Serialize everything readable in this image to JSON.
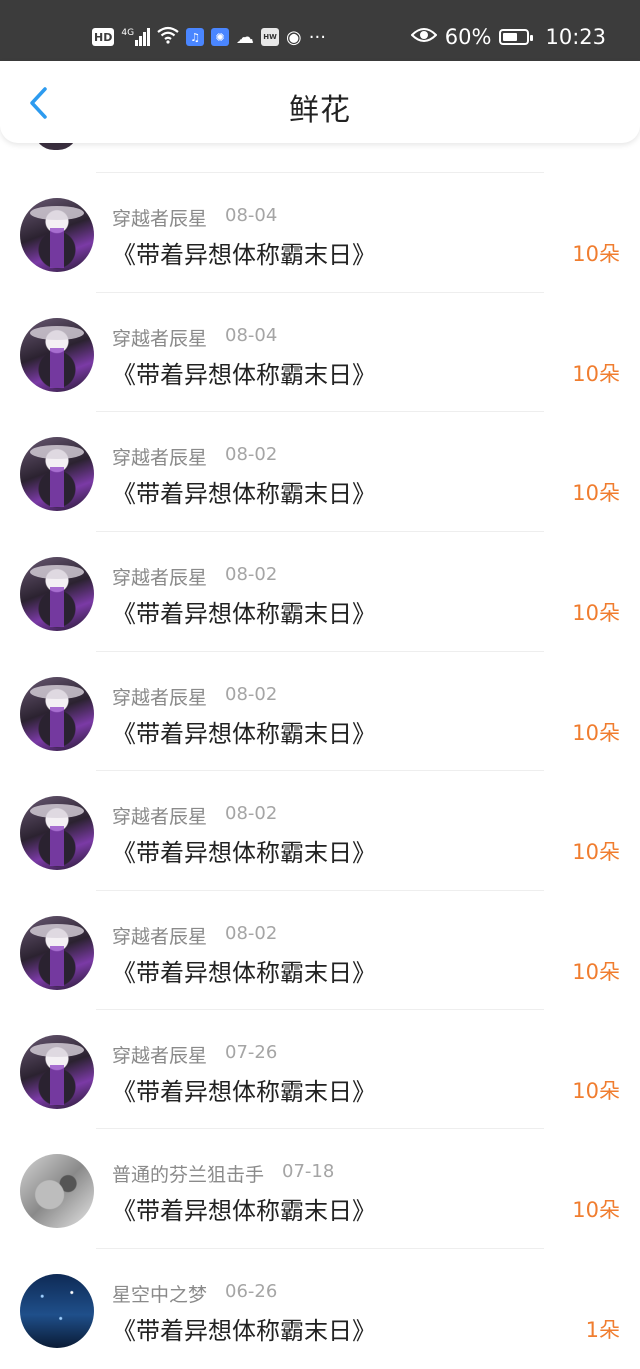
{
  "status_bar": {
    "left_icons": [
      "HD",
      "4G",
      "signal-icon",
      "wifi-icon",
      "app-icon-blue",
      "lightbulb-icon",
      "cloud-icon",
      "huawei-icon",
      "basketball-icon",
      "..."
    ],
    "battery_percent": "60%",
    "battery_level": 0.6,
    "time": "10:23",
    "eye_icon": "eye-icon"
  },
  "header": {
    "back_icon": "chevron-left-icon",
    "title": "鲜花"
  },
  "colors": {
    "accent_blue": "#2d9bef",
    "amount_orange": "#f07d2f",
    "status_bar_bg": "#3c3c3c"
  },
  "rows": [
    {
      "user": "穿越者辰星",
      "date": "08-04",
      "book": "《带着异想体称霸末日》",
      "amount": "10朵",
      "avatar": "anime"
    },
    {
      "user": "穿越者辰星",
      "date": "08-04",
      "book": "《带着异想体称霸末日》",
      "amount": "10朵",
      "avatar": "anime"
    },
    {
      "user": "穿越者辰星",
      "date": "08-02",
      "book": "《带着异想体称霸末日》",
      "amount": "10朵",
      "avatar": "anime"
    },
    {
      "user": "穿越者辰星",
      "date": "08-02",
      "book": "《带着异想体称霸末日》",
      "amount": "10朵",
      "avatar": "anime"
    },
    {
      "user": "穿越者辰星",
      "date": "08-02",
      "book": "《带着异想体称霸末日》",
      "amount": "10朵",
      "avatar": "anime"
    },
    {
      "user": "穿越者辰星",
      "date": "08-02",
      "book": "《带着异想体称霸末日》",
      "amount": "10朵",
      "avatar": "anime"
    },
    {
      "user": "穿越者辰星",
      "date": "08-02",
      "book": "《带着异想体称霸末日》",
      "amount": "10朵",
      "avatar": "anime"
    },
    {
      "user": "穿越者辰星",
      "date": "07-26",
      "book": "《带着异想体称霸末日》",
      "amount": "10朵",
      "avatar": "anime"
    },
    {
      "user": "普通的芬兰狙击手",
      "date": "07-18",
      "book": "《带着异想体称霸末日》",
      "amount": "10朵",
      "avatar": "sketch"
    },
    {
      "user": "星空中之梦",
      "date": "06-26",
      "book": "《带着异想体称霸末日》",
      "amount": "1朵",
      "avatar": "space"
    }
  ]
}
